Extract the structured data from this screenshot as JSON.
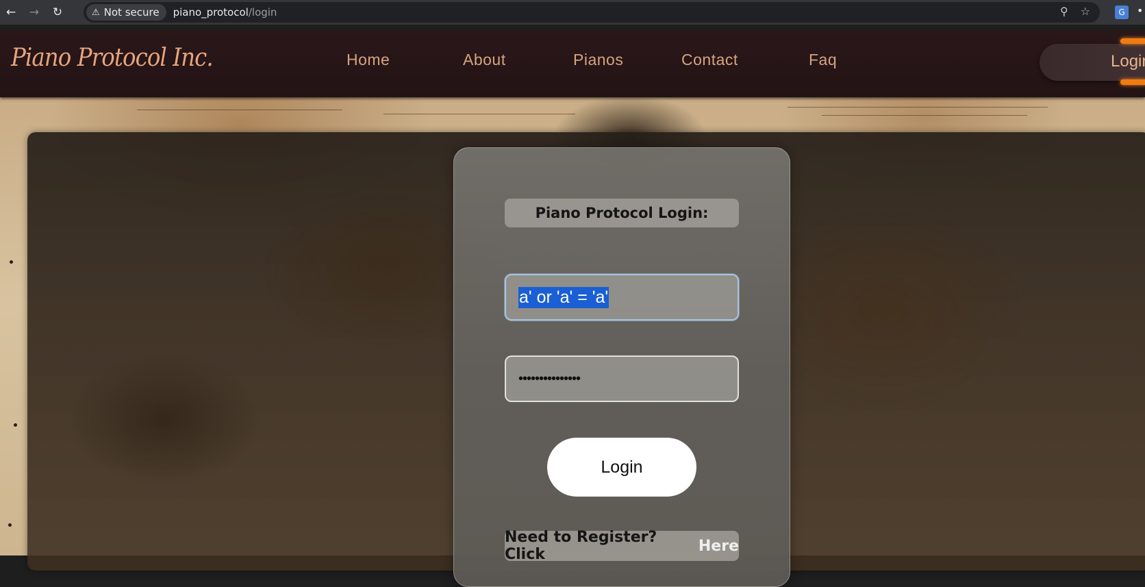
{
  "browser": {
    "security_label": "Not secure",
    "url_host": "piano_protocol",
    "url_path": "/login",
    "icons": [
      "back-icon",
      "forward-icon",
      "reload-icon",
      "warning-icon",
      "key-icon",
      "star-icon",
      "translate-icon"
    ]
  },
  "header": {
    "logo": "Piano Protocol Inc.",
    "nav": [
      "Home",
      "About",
      "Pianos",
      "Contact",
      "Faq"
    ],
    "login_label": "Login"
  },
  "login_card": {
    "title": "Piano Protocol Login:",
    "username_value": "a' or 'a' = 'a'",
    "password_value": "•••••••••••••••",
    "button_label": "Login",
    "register_text": "Need to Register? Click",
    "register_link": "Here"
  },
  "colors": {
    "header_bg": "#231315",
    "nav_text": "#d7a47e",
    "selection": "#1a5fd3",
    "accent_glow": "#f07b12"
  }
}
